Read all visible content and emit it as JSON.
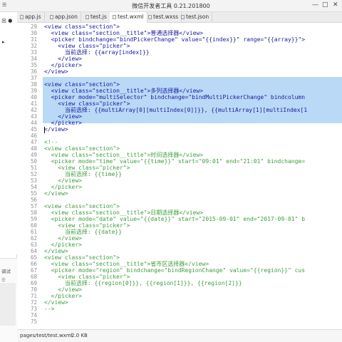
{
  "window": {
    "title": "微信开发者工具 0.21.201800",
    "minimize": "—",
    "maximize": "□",
    "close": "✕"
  },
  "tabs": [
    {
      "label": "app.js",
      "active": false
    },
    {
      "label": "app.json",
      "active": false
    },
    {
      "label": "test.js",
      "active": false
    },
    {
      "label": "test.wxml",
      "active": true
    },
    {
      "label": "test.wxss",
      "active": false
    },
    {
      "label": "test.json",
      "active": false
    }
  ],
  "sidebar": {
    "top_label": "出 ●",
    "dot_label": "▸",
    "bottom_label": "调试",
    "bottom_label2": "☰"
  },
  "code": [
    {
      "n": "29",
      "t": "<view class=\"section\">",
      "indent": 0
    },
    {
      "n": "30",
      "t": "  <view class=\"section__title\">普通选择器</view>",
      "indent": 0
    },
    {
      "n": "31",
      "t": "  <picker bindchange=\"bindPickerChange\" value=\"{{index}}\" range=\"{{array}}\">",
      "indent": 0
    },
    {
      "n": "32",
      "t": "    <view class=\"picker\">",
      "indent": 0
    },
    {
      "n": "33",
      "t": "      当前选择: {{array[index]}}",
      "indent": 0
    },
    {
      "n": "34",
      "t": "    </view>",
      "indent": 0
    },
    {
      "n": "35",
      "t": "  </picker>",
      "indent": 0
    },
    {
      "n": "36",
      "t": "</view>",
      "indent": 0
    },
    {
      "n": "37",
      "t": "",
      "indent": 0
    },
    {
      "n": "38",
      "t": "<view class=\"section\">",
      "indent": 0,
      "sel": true
    },
    {
      "n": "39",
      "t": "  <view class=\"section__title\">多列选择器</view>",
      "indent": 0,
      "sel": true
    },
    {
      "n": "40",
      "t": "  <picker mode=\"multiSelector\" bindchange=\"bindMultiPickerChange\" bindcolumn",
      "indent": 0,
      "sel": true
    },
    {
      "n": "41",
      "t": "    <view class=\"picker\">",
      "indent": 0,
      "sel": true
    },
    {
      "n": "42",
      "t": "      当前选择: {{multiArray[0][multiIndex[0]]}}, {{multiArray[1][multiIndex[1",
      "indent": 0,
      "sel": true
    },
    {
      "n": "43",
      "t": "    </view>",
      "indent": 0,
      "sel": true
    },
    {
      "n": "44",
      "t": "  </picker>",
      "indent": 0,
      "sel": true
    },
    {
      "n": "45",
      "t": "</view>",
      "indent": 0,
      "sel": true
    },
    {
      "n": "46",
      "t": "",
      "indent": 0
    },
    {
      "n": "47",
      "t": "<!--",
      "indent": 0,
      "comment": true
    },
    {
      "n": "48",
      "t": "<view class=\"section\">",
      "indent": 0,
      "comment": true
    },
    {
      "n": "49",
      "t": "  <view class=\"section__title\">时间选择器</view>",
      "indent": 0,
      "comment": true
    },
    {
      "n": "50",
      "t": "  <picker mode=\"time\" value=\"{{time}}\" start=\"09:01\" end=\"21:01\" bindchange=",
      "indent": 0,
      "comment": true
    },
    {
      "n": "51",
      "t": "    <view class=\"picker\">",
      "indent": 0,
      "comment": true
    },
    {
      "n": "52",
      "t": "      当前选择: {{time}}",
      "indent": 0,
      "comment": true
    },
    {
      "n": "53",
      "t": "    </view>",
      "indent": 0,
      "comment": true
    },
    {
      "n": "54",
      "t": "  </picker>",
      "indent": 0,
      "comment": true
    },
    {
      "n": "55",
      "t": "</view>",
      "indent": 0,
      "comment": true
    },
    {
      "n": "56",
      "t": "",
      "indent": 0
    },
    {
      "n": "57",
      "t": "<view class=\"section\">",
      "indent": 0,
      "comment": true
    },
    {
      "n": "58",
      "t": "  <view class=\"section__title\">日期选择器</view>",
      "indent": 0,
      "comment": true
    },
    {
      "n": "59",
      "t": "  <picker mode=\"date\" value=\"{{date}}\" start=\"2015-09-01\" end=\"2017-09-01\" b",
      "indent": 0,
      "comment": true
    },
    {
      "n": "60",
      "t": "    <view class=\"picker\">",
      "indent": 0,
      "comment": true
    },
    {
      "n": "61",
      "t": "      当前选择: {{date}}",
      "indent": 0,
      "comment": true
    },
    {
      "n": "62",
      "t": "    </view>",
      "indent": 0,
      "comment": true
    },
    {
      "n": "63",
      "t": "  </picker>",
      "indent": 0,
      "comment": true
    },
    {
      "n": "64",
      "t": "</view>",
      "indent": 0,
      "comment": true
    },
    {
      "n": "65",
      "t": "<view class=\"section\">",
      "indent": 0,
      "comment": true
    },
    {
      "n": "66",
      "t": "  <view class=\"section__title\">省市区选择器</view>",
      "indent": 0,
      "comment": true
    },
    {
      "n": "67",
      "t": "  <picker mode=\"region\" bindchange=\"bindRegionChange\" value=\"{{region}}\" cus",
      "indent": 0,
      "comment": true
    },
    {
      "n": "68",
      "t": "    <view class=\"picker\">",
      "indent": 0,
      "comment": true
    },
    {
      "n": "69",
      "t": "      当前选择: {{region[0]}}, {{region[1]}}, {{region[2]}}",
      "indent": 0,
      "comment": true
    },
    {
      "n": "70",
      "t": "    </view>",
      "indent": 0,
      "comment": true
    },
    {
      "n": "71",
      "t": "  </picker>",
      "indent": 0,
      "comment": true
    },
    {
      "n": "72",
      "t": "</view>",
      "indent": 0,
      "comment": true
    },
    {
      "n": "73",
      "t": "-->",
      "indent": 0,
      "comment": true
    },
    {
      "n": "74",
      "t": "",
      "indent": 0
    },
    {
      "n": "75",
      "t": "",
      "indent": 0
    }
  ],
  "status": {
    "path": "pages/test/test.wxml",
    "size": "2.0 KB"
  },
  "colors": {
    "code": "#1a1a9c",
    "comment": "#3f9e3f",
    "selection": "#b9d9f7"
  }
}
